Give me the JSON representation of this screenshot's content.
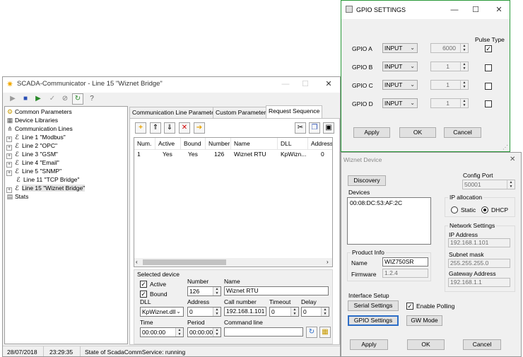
{
  "main_window": {
    "title": "SCADA-Communicator - Line 15 \"Wiznet Bridge\"",
    "titlebar_buttons": [
      "—",
      "☐",
      "✕"
    ],
    "toolbar_icons": [
      "play-icon",
      "stop-icon",
      "restart-icon",
      "check-icon",
      "cancel-icon",
      "refresh-icon",
      "help-icon"
    ],
    "tree": [
      {
        "label": "Common Parameters",
        "icon": "gears-icon",
        "expander": ""
      },
      {
        "label": "Device Libraries",
        "icon": "library-icon",
        "expander": ""
      },
      {
        "label": "Communication Lines",
        "icon": "lines-icon",
        "expander": ""
      },
      {
        "label": "Line 1 \"Modbus\"",
        "icon": "line-icon",
        "expander": "+"
      },
      {
        "label": "Line 2 \"OPC\"",
        "icon": "line-icon",
        "expander": "+"
      },
      {
        "label": "Line 3 \"GSM\"",
        "icon": "line-icon",
        "expander": "+"
      },
      {
        "label": "Line 4 \"Email\"",
        "icon": "line-icon",
        "expander": "+"
      },
      {
        "label": "Line 5 \"SNMP\"",
        "icon": "line-icon",
        "expander": "+"
      },
      {
        "label": "Line 11 \"TCP Bridge\"",
        "icon": "line-icon",
        "expander": ""
      },
      {
        "label": "Line 15 \"Wiznet Bridge\"",
        "icon": "line-icon",
        "expander": "+"
      },
      {
        "label": "Stats",
        "icon": "stats-icon",
        "expander": ""
      }
    ],
    "tabs": [
      "Communication Line Parameters",
      "Custom Parameters",
      "Request Sequence"
    ],
    "seq_toolbar_icons": [
      "add-icon",
      "move-up-icon",
      "move-down-icon",
      "delete-icon",
      "arrow-right-icon",
      "cut-icon",
      "copy-icon",
      "paste-icon"
    ],
    "table": {
      "headers": [
        "Num.",
        "Active",
        "Bound",
        "Number",
        "Name",
        "DLL",
        "Address"
      ],
      "rows": [
        [
          "1",
          "Yes",
          "Yes",
          "126",
          "Wiznet RTU",
          "KpWizn...",
          "0"
        ]
      ]
    },
    "selected_device": {
      "group_title": "Selected device",
      "active_label": "Active",
      "bound_label": "Bound",
      "number_label": "Number",
      "number_value": "126",
      "name_label": "Name",
      "name_value": "Wiznet RTU",
      "dll_label": "DLL",
      "dll_value": "KpWiznet.dll",
      "address_label": "Address",
      "address_value": "0",
      "call_label": "Call number",
      "call_value": "192.168.1.101",
      "timeout_label": "Timeout",
      "timeout_value": "0",
      "delay_label": "Delay",
      "delay_value": "0",
      "time_label": "Time",
      "time_value": "00:00:00",
      "period_label": "Period",
      "period_value": "00:00:00",
      "cmdline_label": "Command line",
      "cmdline_value": ""
    },
    "status": {
      "date": "28/07/2018",
      "time": "23:29:35",
      "service": "State of ScadaCommService: running"
    }
  },
  "gpio_window": {
    "title": "GPIO SETTINGS",
    "titlebar_buttons": [
      "—",
      "☐",
      "✕"
    ],
    "pulse_type_label": "Pulse Type",
    "rows": [
      {
        "label": "GPIO A",
        "mode": "INPUT",
        "value": "6000",
        "checked": true
      },
      {
        "label": "GPIO B",
        "mode": "INPUT",
        "value": "1",
        "checked": false
      },
      {
        "label": "GPIO C",
        "mode": "INPUT",
        "value": "1",
        "checked": false
      },
      {
        "label": "GPIO D",
        "mode": "INPUT",
        "value": "1",
        "checked": false
      }
    ],
    "apply": "Apply",
    "ok": "OK",
    "cancel": "Cancel"
  },
  "wiznet_window": {
    "title": "Wiznet Device",
    "discovery": "Discovery",
    "config_port_label": "Config Port",
    "config_port_value": "50001",
    "devices_label": "Devices",
    "devices": [
      "00:08:DC:53:AF:2C"
    ],
    "ip_alloc_title": "IP allocation",
    "static_label": "Static",
    "dhcp_label": "DHCP",
    "network_title": "Network Settings",
    "ip_label": "IP Address",
    "ip_value": "192.168.1.101",
    "subnet_label": "Subnet mask",
    "subnet_value": "255.255.255.0",
    "gateway_label": "Gateway Address",
    "gateway_value": "192.168.1.1",
    "product_title": "Product Info",
    "product_name_label": "Name",
    "product_name_value": "WIZ750SR",
    "firmware_label": "Firmware",
    "firmware_value": "1.2.4",
    "interface_title": "Interface Setup",
    "serial_settings": "Serial Settings",
    "enable_polling": "Enable Polling",
    "gpio_settings": "GPIO Settings",
    "gw_mode": "GW Mode",
    "apply": "Apply",
    "ok": "OK",
    "cancel": "Cancel"
  }
}
